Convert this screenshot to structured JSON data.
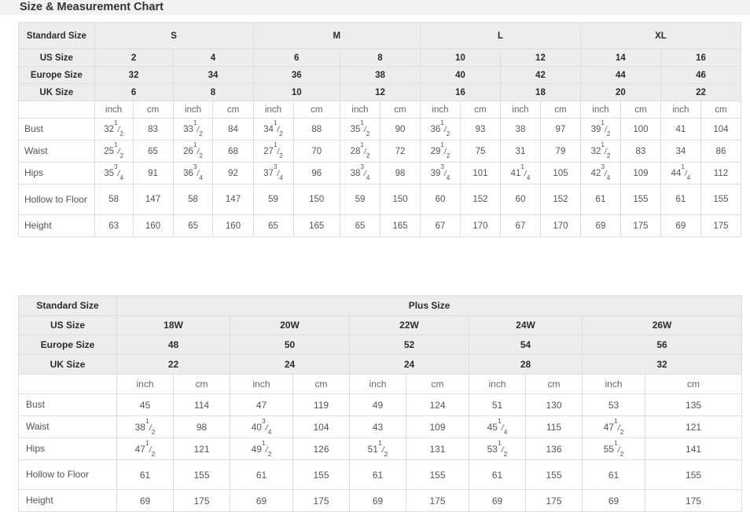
{
  "header": {
    "title": "Size & Measurement Chart"
  },
  "colors": {
    "title_band_bg": "#f2f2f2",
    "header_cell_bg": "#ededed",
    "cell_bg": "#ffffff",
    "border": "#dedede",
    "outer_border": "#c8c8c8",
    "label_text": "#2b2b2b",
    "value_text": "#555555"
  },
  "standard_table": {
    "corner_label": "Standard Size",
    "groups": [
      {
        "label": "S",
        "span": 4
      },
      {
        "label": "M",
        "span": 4
      },
      {
        "label": "L",
        "span": 4
      },
      {
        "label": "XL",
        "span": 4
      }
    ],
    "size_rows": [
      {
        "label": "US Size",
        "values": [
          "2",
          "4",
          "6",
          "8",
          "10",
          "12",
          "14",
          "16"
        ]
      },
      {
        "label": "Europe Size",
        "values": [
          "32",
          "34",
          "36",
          "38",
          "40",
          "42",
          "44",
          "46"
        ]
      },
      {
        "label": "UK Size",
        "values": [
          "6",
          "8",
          "10",
          "12",
          "16",
          "18",
          "20",
          "22"
        ]
      }
    ],
    "unit_row": {
      "label": "",
      "units": [
        "inch",
        "cm",
        "inch",
        "cm",
        "inch",
        "cm",
        "inch",
        "cm",
        "inch",
        "cm",
        "inch",
        "cm",
        "inch",
        "cm",
        "inch",
        "cm"
      ]
    },
    "measure_rows": [
      {
        "label": "Bust",
        "values": [
          {
            "whole": "32",
            "num": "1",
            "den": "2"
          },
          {
            "whole": "83"
          },
          {
            "whole": "33",
            "num": "1",
            "den": "2"
          },
          {
            "whole": "84"
          },
          {
            "whole": "34",
            "num": "1",
            "den": "2"
          },
          {
            "whole": "88"
          },
          {
            "whole": "35",
            "num": "1",
            "den": "2"
          },
          {
            "whole": "90"
          },
          {
            "whole": "36",
            "num": "1",
            "den": "2"
          },
          {
            "whole": "93"
          },
          {
            "whole": "38"
          },
          {
            "whole": "97"
          },
          {
            "whole": "39",
            "num": "1",
            "den": "2"
          },
          {
            "whole": "100"
          },
          {
            "whole": "41"
          },
          {
            "whole": "104"
          }
        ]
      },
      {
        "label": "Waist",
        "values": [
          {
            "whole": "25",
            "num": "1",
            "den": "2"
          },
          {
            "whole": "65"
          },
          {
            "whole": "26",
            "num": "1",
            "den": "2"
          },
          {
            "whole": "68"
          },
          {
            "whole": "27",
            "num": "1",
            "den": "2"
          },
          {
            "whole": "70"
          },
          {
            "whole": "28",
            "num": "1",
            "den": "2"
          },
          {
            "whole": "72"
          },
          {
            "whole": "29",
            "num": "1",
            "den": "2"
          },
          {
            "whole": "75"
          },
          {
            "whole": "31"
          },
          {
            "whole": "79"
          },
          {
            "whole": "32",
            "num": "1",
            "den": "2"
          },
          {
            "whole": "83"
          },
          {
            "whole": "34"
          },
          {
            "whole": "86"
          }
        ]
      },
      {
        "label": "Hips",
        "values": [
          {
            "whole": "35",
            "num": "3",
            "den": "4"
          },
          {
            "whole": "91"
          },
          {
            "whole": "36",
            "num": "3",
            "den": "4"
          },
          {
            "whole": "92"
          },
          {
            "whole": "37",
            "num": "3",
            "den": "4"
          },
          {
            "whole": "96"
          },
          {
            "whole": "38",
            "num": "3",
            "den": "4"
          },
          {
            "whole": "98"
          },
          {
            "whole": "39",
            "num": "3",
            "den": "4"
          },
          {
            "whole": "101"
          },
          {
            "whole": "41",
            "num": "1",
            "den": "4"
          },
          {
            "whole": "105"
          },
          {
            "whole": "42",
            "num": "3",
            "den": "4"
          },
          {
            "whole": "109"
          },
          {
            "whole": "44",
            "num": "1",
            "den": "4"
          },
          {
            "whole": "112"
          }
        ]
      },
      {
        "label": "Hollow to Floor",
        "tall": true,
        "values": [
          {
            "whole": "58"
          },
          {
            "whole": "147"
          },
          {
            "whole": "58"
          },
          {
            "whole": "147"
          },
          {
            "whole": "59"
          },
          {
            "whole": "150"
          },
          {
            "whole": "59"
          },
          {
            "whole": "150"
          },
          {
            "whole": "60"
          },
          {
            "whole": "152"
          },
          {
            "whole": "60"
          },
          {
            "whole": "152"
          },
          {
            "whole": "61"
          },
          {
            "whole": "155"
          },
          {
            "whole": "61"
          },
          {
            "whole": "155"
          }
        ]
      },
      {
        "label": "Height",
        "values": [
          {
            "whole": "63"
          },
          {
            "whole": "160"
          },
          {
            "whole": "65"
          },
          {
            "whole": "160"
          },
          {
            "whole": "65"
          },
          {
            "whole": "165"
          },
          {
            "whole": "65"
          },
          {
            "whole": "165"
          },
          {
            "whole": "67"
          },
          {
            "whole": "170"
          },
          {
            "whole": "67"
          },
          {
            "whole": "170"
          },
          {
            "whole": "69"
          },
          {
            "whole": "175"
          },
          {
            "whole": "69"
          },
          {
            "whole": "175"
          }
        ]
      }
    ]
  },
  "plus_table": {
    "corner_label": "Standard Size",
    "group_label": "Plus Size",
    "size_rows": [
      {
        "label": "US Size",
        "values": [
          "18W",
          "20W",
          "22W",
          "24W",
          "26W"
        ]
      },
      {
        "label": "Europe Size",
        "values": [
          "48",
          "50",
          "52",
          "54",
          "56"
        ]
      },
      {
        "label": "UK Size",
        "values": [
          "22",
          "24",
          "24",
          "28",
          "32"
        ]
      }
    ],
    "unit_row": {
      "label": "",
      "units": [
        "inch",
        "cm",
        "inch",
        "cm",
        "inch",
        "cm",
        "inch",
        "cm",
        "inch",
        "cm"
      ]
    },
    "measure_rows": [
      {
        "label": "Bust",
        "values": [
          {
            "whole": "45"
          },
          {
            "whole": "114"
          },
          {
            "whole": "47"
          },
          {
            "whole": "119"
          },
          {
            "whole": "49"
          },
          {
            "whole": "124"
          },
          {
            "whole": "51"
          },
          {
            "whole": "130"
          },
          {
            "whole": "53"
          },
          {
            "whole": "135"
          }
        ]
      },
      {
        "label": "Waist",
        "values": [
          {
            "whole": "38",
            "num": "1",
            "den": "2"
          },
          {
            "whole": "98"
          },
          {
            "whole": "40",
            "num": "3",
            "den": "4"
          },
          {
            "whole": "104"
          },
          {
            "whole": "43"
          },
          {
            "whole": "109"
          },
          {
            "whole": "45",
            "num": "1",
            "den": "4"
          },
          {
            "whole": "115"
          },
          {
            "whole": "47",
            "num": "1",
            "den": "2"
          },
          {
            "whole": "121"
          }
        ]
      },
      {
        "label": "Hips",
        "values": [
          {
            "whole": "47",
            "num": "1",
            "den": "2"
          },
          {
            "whole": "121"
          },
          {
            "whole": "49",
            "num": "1",
            "den": "2"
          },
          {
            "whole": "126"
          },
          {
            "whole": "51",
            "num": "1",
            "den": "2"
          },
          {
            "whole": "131"
          },
          {
            "whole": "53",
            "num": "1",
            "den": "2"
          },
          {
            "whole": "136"
          },
          {
            "whole": "55",
            "num": "1",
            "den": "2"
          },
          {
            "whole": "141"
          }
        ]
      },
      {
        "label": "Hollow to Floor",
        "tall": true,
        "values": [
          {
            "whole": "61"
          },
          {
            "whole": "155"
          },
          {
            "whole": "61"
          },
          {
            "whole": "155"
          },
          {
            "whole": "61"
          },
          {
            "whole": "155"
          },
          {
            "whole": "61"
          },
          {
            "whole": "155"
          },
          {
            "whole": "61"
          },
          {
            "whole": "155"
          }
        ]
      },
      {
        "label": "Height",
        "values": [
          {
            "whole": "69"
          },
          {
            "whole": "175"
          },
          {
            "whole": "69"
          },
          {
            "whole": "175"
          },
          {
            "whole": "69"
          },
          {
            "whole": "175"
          },
          {
            "whole": "69"
          },
          {
            "whole": "175"
          },
          {
            "whole": "69"
          },
          {
            "whole": "175"
          }
        ]
      }
    ]
  }
}
